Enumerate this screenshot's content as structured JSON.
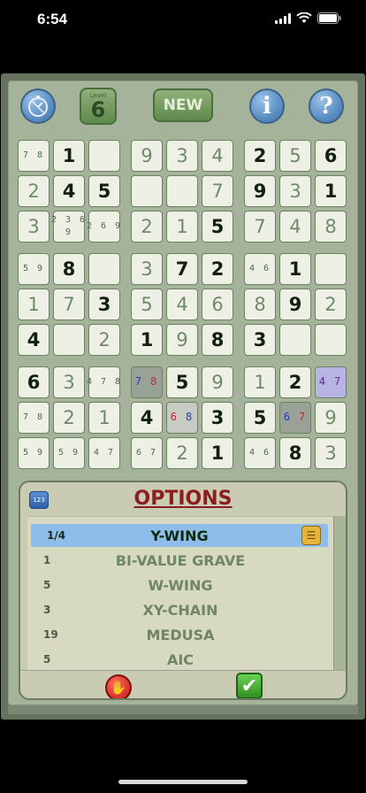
{
  "status": {
    "time": "6:54"
  },
  "toolbar": {
    "level_caption": "Level",
    "level_value": "6",
    "new_label": "NEW",
    "info_glyph": "i",
    "help_glyph": "?"
  },
  "grid": {
    "rows": [
      [
        {
          "c": "7 8"
        },
        {
          "v": "1",
          "g": 1
        },
        {
          "v": ""
        },
        {
          "v": "9"
        },
        {
          "v": "3"
        },
        {
          "v": "4"
        },
        {
          "v": "2",
          "g": 1
        },
        {
          "v": "5"
        },
        {
          "v": "6",
          "g": 1
        }
      ],
      [
        {
          "v": "2"
        },
        {
          "v": "4",
          "g": 1
        },
        {
          "v": "5",
          "g": 1
        },
        {
          "v": ""
        },
        {
          "v": ""
        },
        {
          "v": "7"
        },
        {
          "v": "9",
          "g": 1
        },
        {
          "v": "3"
        },
        {
          "v": "1",
          "g": 1
        }
      ],
      [
        {
          "v": "3"
        },
        {
          "c": "2 3 6\n9"
        },
        {
          "c": "2 6 9"
        },
        {
          "v": "2"
        },
        {
          "v": "1"
        },
        {
          "v": "5",
          "g": 1
        },
        {
          "v": "7"
        },
        {
          "v": "4"
        },
        {
          "v": "8"
        }
      ],
      [
        {
          "c": "5 9"
        },
        {
          "v": "8",
          "g": 1
        },
        {
          "v": ""
        },
        {
          "v": "3"
        },
        {
          "v": "7",
          "g": 1
        },
        {
          "v": "2",
          "g": 1
        },
        {
          "c": "4 6"
        },
        {
          "v": "1",
          "g": 1
        },
        {
          "v": ""
        }
      ],
      [
        {
          "v": "1"
        },
        {
          "v": "7"
        },
        {
          "v": "3",
          "g": 1
        },
        {
          "v": "5"
        },
        {
          "v": "4"
        },
        {
          "v": "6"
        },
        {
          "v": "8"
        },
        {
          "v": "9",
          "g": 1
        },
        {
          "v": "2"
        }
      ],
      [
        {
          "v": "4",
          "g": 1
        },
        {
          "v": ""
        },
        {
          "v": "2"
        },
        {
          "v": "1",
          "g": 1
        },
        {
          "v": "9"
        },
        {
          "v": "8",
          "g": 1
        },
        {
          "v": "3",
          "g": 1
        },
        {
          "v": ""
        },
        {
          "v": ""
        }
      ],
      [
        {
          "v": "6",
          "g": 1
        },
        {
          "v": "3"
        },
        {
          "c": "4 7 8"
        },
        {
          "c": "7 8",
          "hl": "gray",
          "cc": [
            "b",
            "r"
          ]
        },
        {
          "v": "5",
          "g": 1
        },
        {
          "v": "9"
        },
        {
          "v": "1"
        },
        {
          "v": "2",
          "g": 1
        },
        {
          "c": "4 7",
          "hl": "purple",
          "cc": [
            "p",
            "p"
          ]
        }
      ],
      [
        {
          "c": "7 8"
        },
        {
          "v": "2"
        },
        {
          "v": "1"
        },
        {
          "v": "4",
          "g": 1
        },
        {
          "c": "6 8",
          "hl": "lgray",
          "cc": [
            "r",
            "b"
          ]
        },
        {
          "v": "3",
          "g": 1
        },
        {
          "v": "5",
          "g": 1
        },
        {
          "c": "6 7",
          "hl": "gray",
          "cc": [
            "b",
            "r"
          ]
        },
        {
          "v": "9"
        }
      ],
      [
        {
          "c": "5 9"
        },
        {
          "c": "5 9"
        },
        {
          "c": "4 7"
        },
        {
          "c": "6 7"
        },
        {
          "v": "2"
        },
        {
          "v": "1",
          "g": 1
        },
        {
          "c": "4 6"
        },
        {
          "v": "8",
          "g": 1
        },
        {
          "v": "3"
        }
      ]
    ]
  },
  "options": {
    "title": "OPTIONS",
    "badge": "123",
    "items": [
      {
        "count": "1/4",
        "name": "Y-WING",
        "selected": true
      },
      {
        "count": "1",
        "name": "BI-VALUE GRAVE"
      },
      {
        "count": "5",
        "name": "W-WING"
      },
      {
        "count": "3",
        "name": "XY-CHAIN"
      },
      {
        "count": "19",
        "name": "MEDUSA"
      },
      {
        "count": "5",
        "name": "AIC"
      }
    ]
  },
  "colors": {
    "frame": "#66735f",
    "accent_blue": "#5b8fc4",
    "title_red": "#8b1f1f"
  },
  "icons": [
    "stopwatch-icon",
    "info-icon",
    "help-icon",
    "clipboard-icon",
    "stop-hand-icon",
    "checkmark-icon",
    "wifi-icon",
    "battery-icon"
  ]
}
